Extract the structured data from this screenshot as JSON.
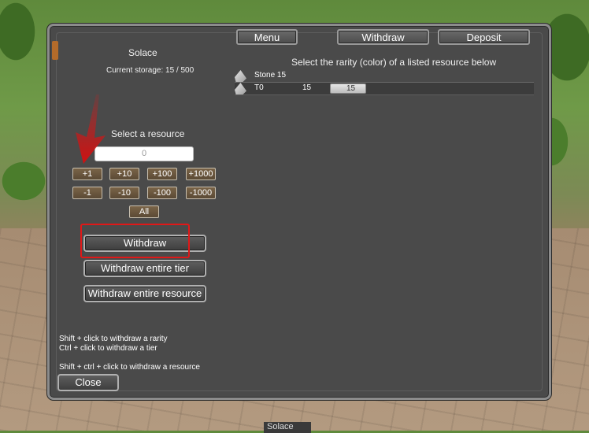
{
  "background": {
    "bottom_sign": "Solace"
  },
  "storage": {
    "name": "Solace",
    "capacity_text": "Current storage: 15 / 500"
  },
  "top_buttons": {
    "menu": "Menu",
    "withdraw": "Withdraw",
    "deposit": "Deposit"
  },
  "rarity_prompt": "Select the rarity (color) of a listed resource below",
  "resources": [
    {
      "label": "Stone 15"
    },
    {
      "tier": "T0",
      "amount": "15",
      "badge": "15"
    }
  ],
  "select_resource_label": "Select a resource",
  "quantity_input": {
    "value": "0"
  },
  "step_buttons": {
    "plus": [
      "+1",
      "+10",
      "+100",
      "+1000"
    ],
    "minus": [
      "-1",
      "-10",
      "-100",
      "-1000"
    ],
    "all": "All"
  },
  "actions": {
    "withdraw": "Withdraw",
    "withdraw_tier": "Withdraw entire tier",
    "withdraw_resource": "Withdraw entire resource"
  },
  "help": [
    "Shift + click to withdraw a rarity",
    "Ctrl + click to withdraw a tier",
    "Shift + ctrl + click to withdraw a resource"
  ],
  "close_label": "Close",
  "annotation_color": "#e01818"
}
